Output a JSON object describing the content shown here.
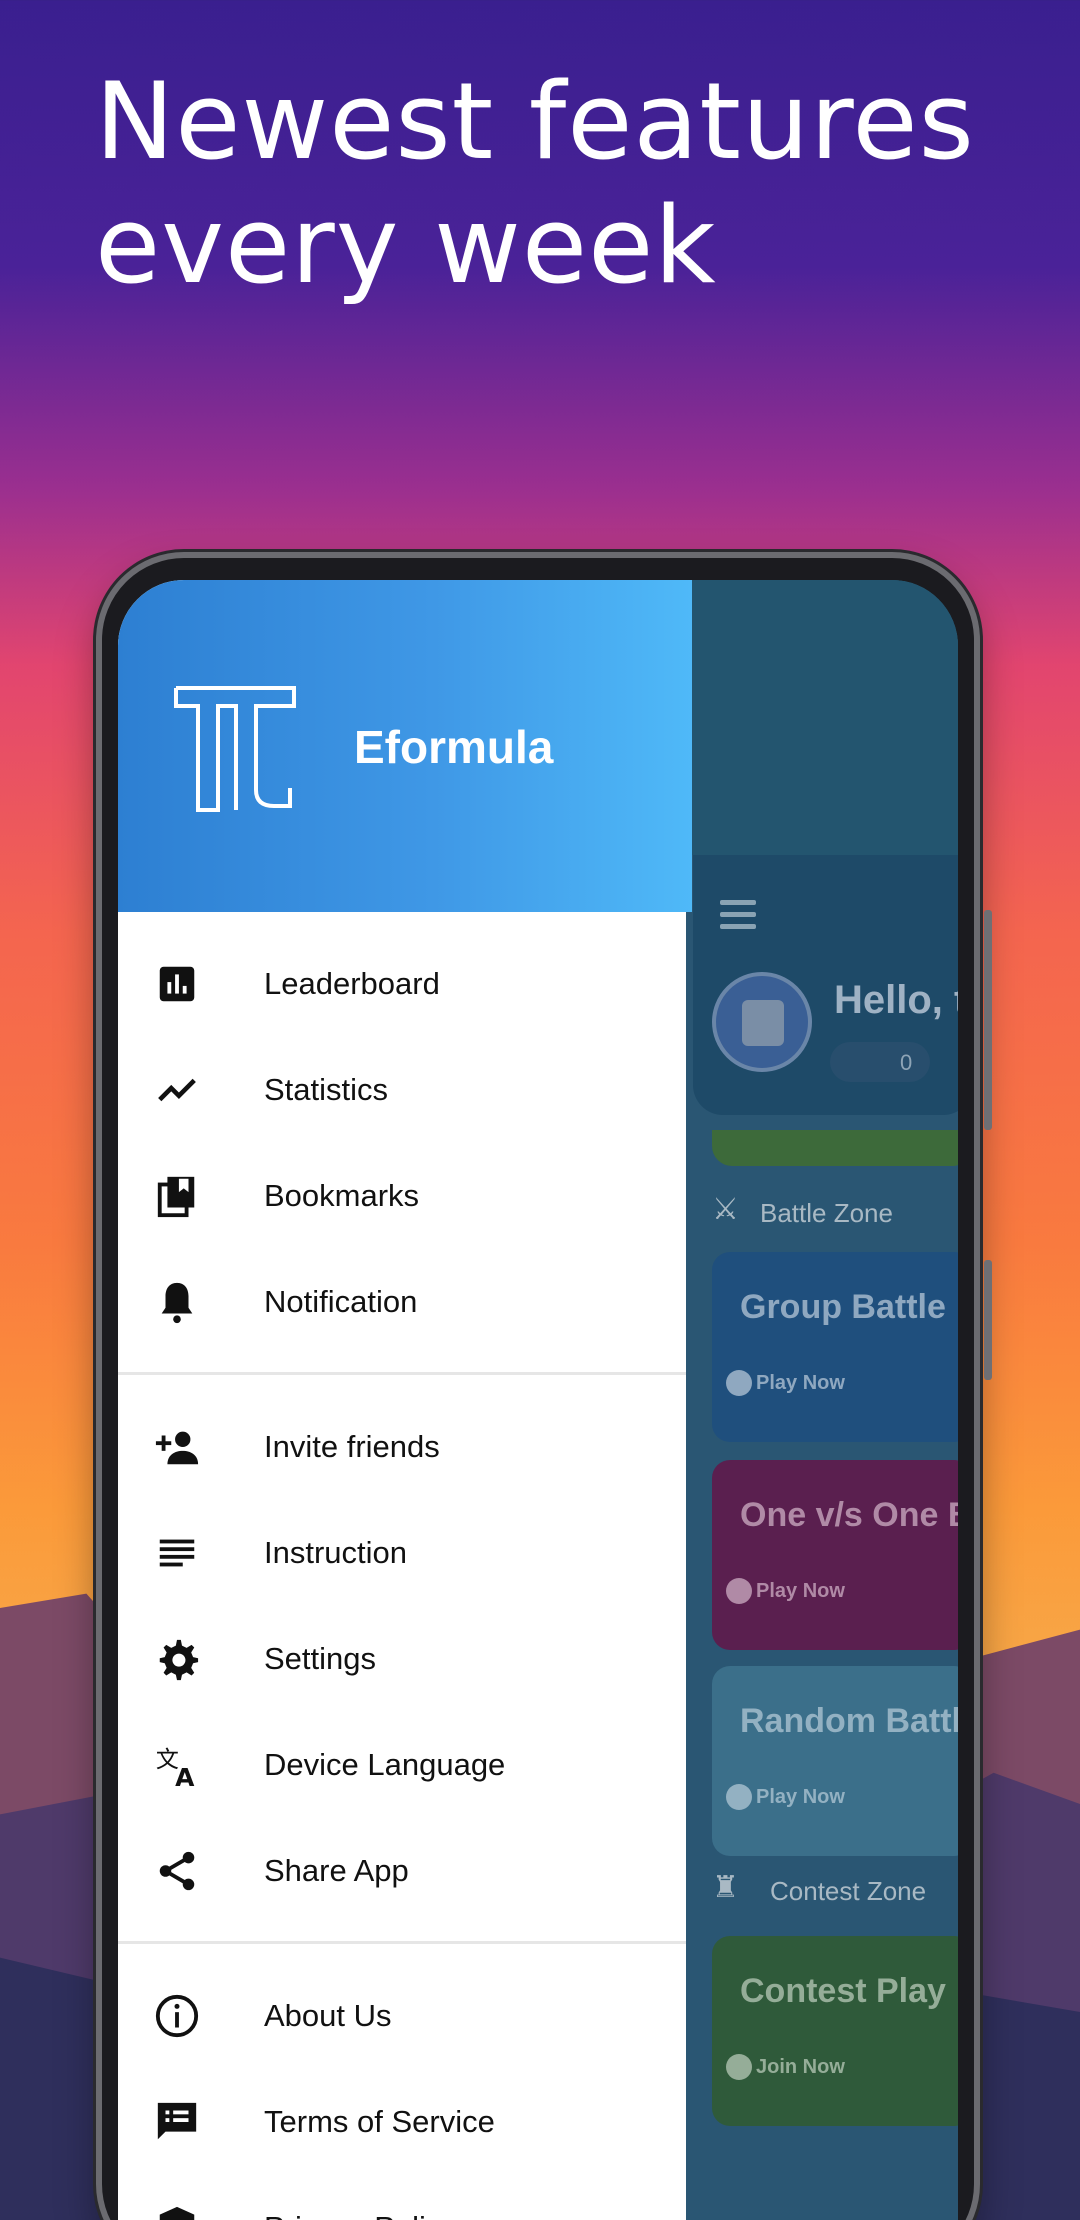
{
  "headline": "Newest features every week",
  "drawer": {
    "brand": "Eformula",
    "sections": [
      [
        {
          "label": "Leaderboard",
          "icon": "leaderboard-icon"
        },
        {
          "label": "Statistics",
          "icon": "statistics-icon"
        },
        {
          "label": "Bookmarks",
          "icon": "bookmarks-icon"
        },
        {
          "label": "Notification",
          "icon": "bell-icon"
        }
      ],
      [
        {
          "label": "Invite friends",
          "icon": "add-person-icon"
        },
        {
          "label": "Instruction",
          "icon": "instruction-icon"
        },
        {
          "label": "Settings",
          "icon": "gear-icon"
        },
        {
          "label": "Device Language",
          "icon": "translate-icon"
        },
        {
          "label": "Share App",
          "icon": "share-icon"
        }
      ],
      [
        {
          "label": "About Us",
          "icon": "info-icon"
        },
        {
          "label": "Terms of Service",
          "icon": "terms-icon"
        },
        {
          "label": "Privacy Policy",
          "icon": "shield-icon"
        }
      ]
    ]
  },
  "app": {
    "greeting": "Hello, t",
    "coins": "0",
    "battle_zone": "Battle Zone",
    "contest_zone": "Contest Zone",
    "cards": [
      {
        "title": "Group Battle",
        "action": "Play Now",
        "color": "#1f4f7d",
        "text_color": "#8fa8c0"
      },
      {
        "title": "One v/s One B",
        "action": "Play Now",
        "color": "#5a1f4f",
        "text_color": "#b08aa6"
      },
      {
        "title": "Random Battl",
        "action": "Play Now",
        "color": "#3b6f8a",
        "text_color": "#93b1c2"
      },
      {
        "title": "Contest Play",
        "action": "Join Now",
        "color": "#2f5a3a",
        "text_color": "#95ad98"
      }
    ]
  }
}
